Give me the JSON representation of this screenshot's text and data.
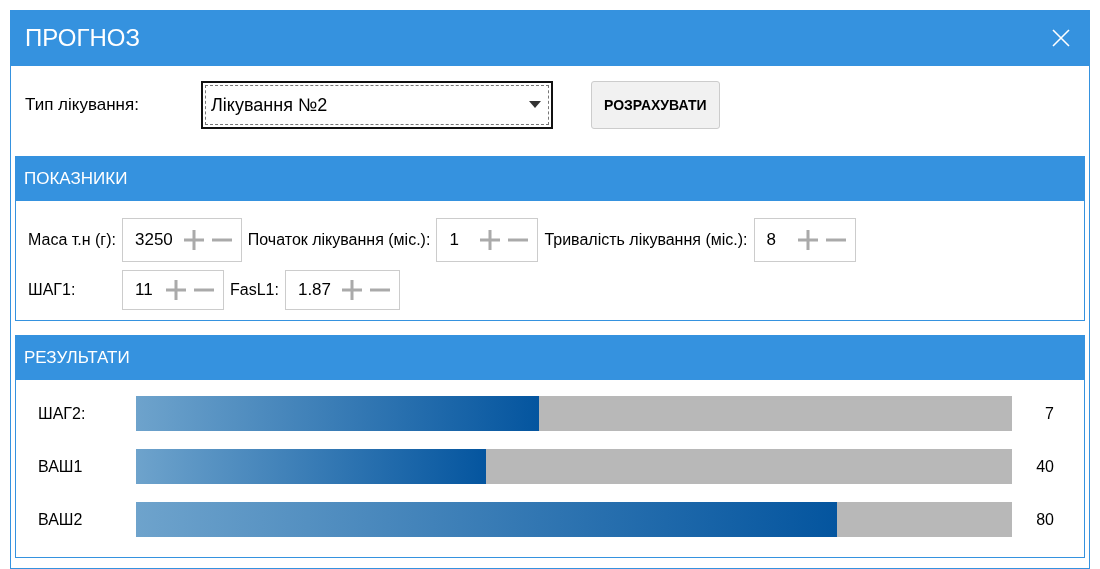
{
  "window": {
    "title": "ПРОГНОЗ"
  },
  "treatment": {
    "label": "Тип лікування:",
    "value": "Лікування №2"
  },
  "calculate_button": "РОЗРАХУВАТИ",
  "indicators": {
    "title": "ПОКАЗНИКИ",
    "rows": [
      [
        {
          "label": "Маса т.н (г):",
          "value": "3250"
        },
        {
          "label": "Початок лікування (міс.):",
          "value": "1"
        },
        {
          "label": "Тривалість лікування (міс.):",
          "value": "8"
        }
      ],
      [
        {
          "label": "ШАГ1:",
          "value": "11"
        },
        {
          "label": "FasL1:",
          "value": "1.87"
        }
      ]
    ]
  },
  "results": {
    "title": "РЕЗУЛЬТАТИ",
    "items": [
      {
        "label": "ШАГ2:",
        "level": 0.46,
        "reading": "7"
      },
      {
        "label": "ВАШ1",
        "level": 0.4,
        "reading": "40"
      },
      {
        "label": "ВАШ2",
        "level": 0.8,
        "reading": "80"
      }
    ]
  }
}
